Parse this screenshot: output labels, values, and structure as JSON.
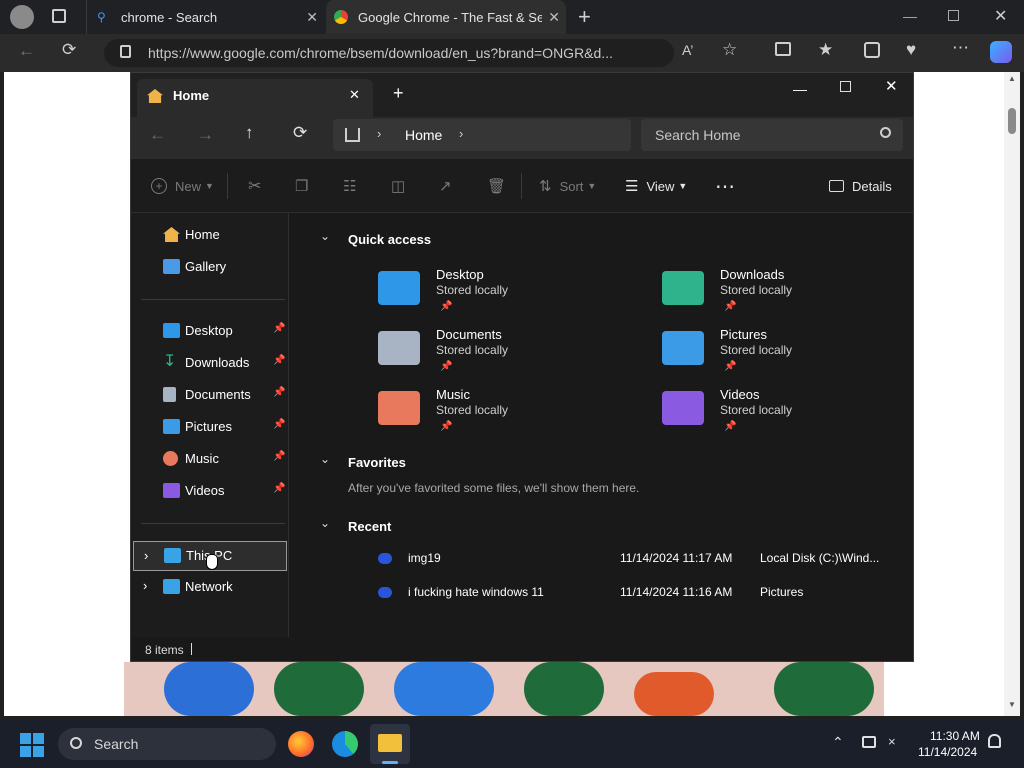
{
  "browser": {
    "tabs": [
      {
        "title": "chrome - Search"
      },
      {
        "title": "Google Chrome - The Fast & Sec"
      }
    ],
    "url": "https://www.google.com/chrome/bsem/download/en_us?brand=ONGR&d..."
  },
  "explorer": {
    "tab_title": "Home",
    "breadcrumb": [
      "Home"
    ],
    "search_placeholder": "Search Home",
    "toolbar": {
      "new": "New",
      "sort": "Sort",
      "view": "View",
      "details": "Details"
    },
    "sidebar": {
      "top": [
        {
          "label": "Home",
          "icon": "home-icon",
          "color": "#f0b34a"
        },
        {
          "label": "Gallery",
          "icon": "gallery-icon",
          "color": "#4a9ae8"
        }
      ],
      "pinned": [
        {
          "label": "Desktop",
          "icon": "desktop-folder-icon",
          "color": "#2f97e8"
        },
        {
          "label": "Downloads",
          "icon": "downloads-folder-icon",
          "color": "#2fb38d"
        },
        {
          "label": "Documents",
          "icon": "documents-folder-icon",
          "color": "#a8b4c4"
        },
        {
          "label": "Pictures",
          "icon": "pictures-folder-icon",
          "color": "#3c9be6"
        },
        {
          "label": "Music",
          "icon": "music-folder-icon",
          "color": "#e8795c"
        },
        {
          "label": "Videos",
          "icon": "videos-folder-icon",
          "color": "#8a5ae0"
        }
      ],
      "drives": [
        {
          "label": "This PC",
          "icon": "this-pc-icon",
          "color": "#3aa3e6"
        },
        {
          "label": "Network",
          "icon": "network-icon",
          "color": "#3aa3e6"
        }
      ]
    },
    "quick_access": {
      "heading": "Quick access",
      "items": [
        {
          "name": "Desktop",
          "sub": "Stored locally",
          "color": "#2f97e8"
        },
        {
          "name": "Downloads",
          "sub": "Stored locally",
          "color": "#2fb38d"
        },
        {
          "name": "Documents",
          "sub": "Stored locally",
          "color": "#a8b4c4"
        },
        {
          "name": "Pictures",
          "sub": "Stored locally",
          "color": "#3c9be6"
        },
        {
          "name": "Music",
          "sub": "Stored locally",
          "color": "#e8795c"
        },
        {
          "name": "Videos",
          "sub": "Stored locally",
          "color": "#8a5ae0"
        }
      ]
    },
    "favorites": {
      "heading": "Favorites",
      "empty": "After you've favorited some files, we'll show them here."
    },
    "recent": {
      "heading": "Recent",
      "rows": [
        {
          "name": "img19",
          "date": "11/14/2024 11:17 AM",
          "location": "Local Disk (C:)\\Wind..."
        },
        {
          "name": "i fucking hate windows 11",
          "date": "11/14/2024 11:16 AM",
          "location": "Pictures"
        }
      ]
    },
    "status": "8 items"
  },
  "taskbar": {
    "search": "Search",
    "time": "11:30 AM",
    "date": "11/14/2024"
  }
}
